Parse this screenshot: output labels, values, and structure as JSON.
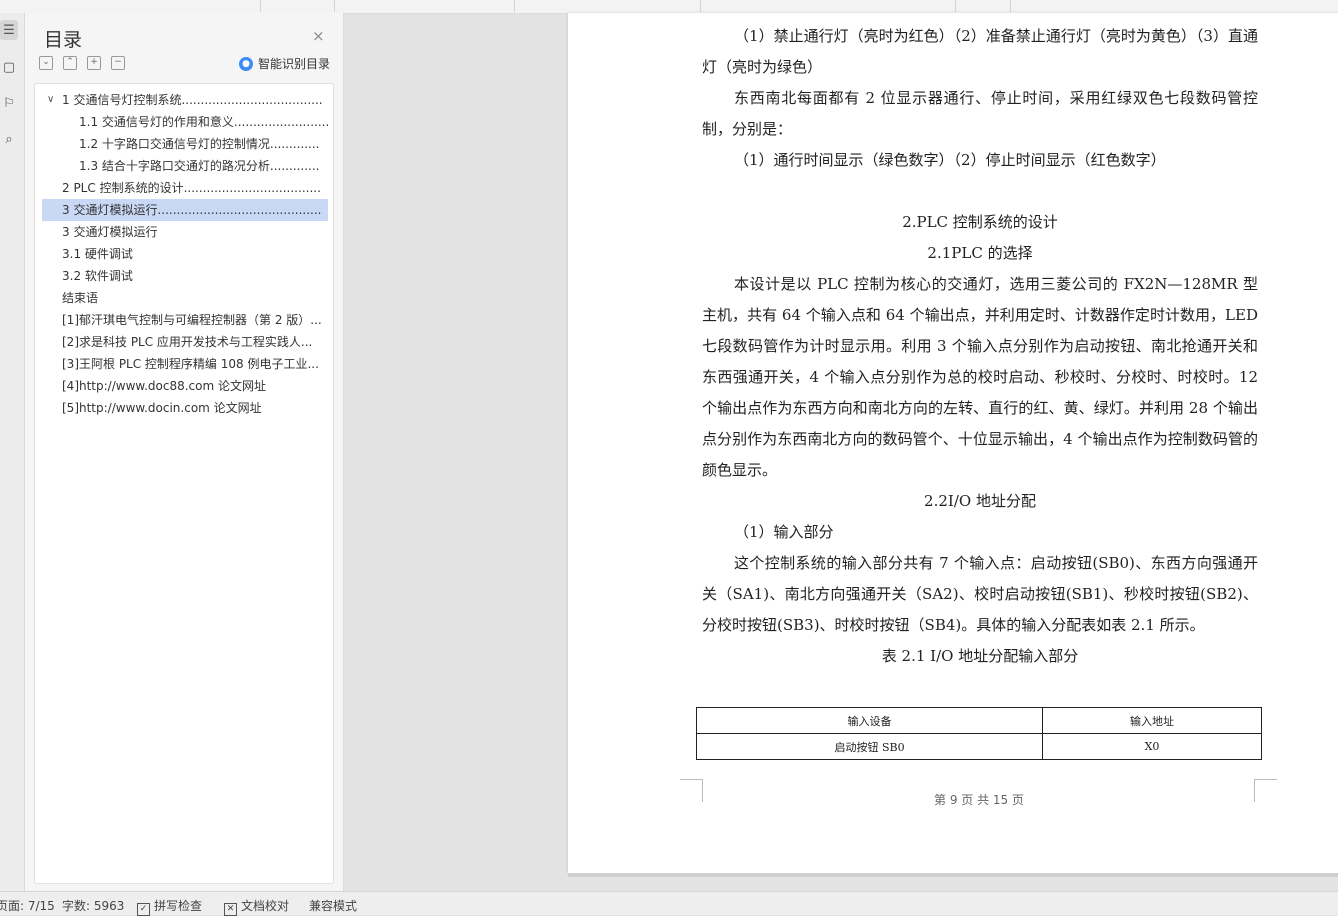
{
  "sidebar_rail": {
    "icons": [
      "toc-icon",
      "pages-icon",
      "bookmark-icon",
      "search-icon"
    ]
  },
  "toc": {
    "title": "目录",
    "close": "×",
    "tools": [
      "⌄",
      "⌃",
      "+",
      "−"
    ],
    "smart_button": "智能识别目录",
    "items": [
      {
        "label": "1 交通信号灯控制系统.......................................",
        "level": 1,
        "expanded": true
      },
      {
        "label": "1.1 交通信号灯的作用和意义...........................",
        "level": 2
      },
      {
        "label": "1.2 十字路口交通信号灯的控制情况.............",
        "level": 2
      },
      {
        "label": "1.3 结合十字路口交通灯的路况分析.............",
        "level": 2
      },
      {
        "label": "2 PLC 控制系统的设计.....................................",
        "level": 1
      },
      {
        "label": "3 交通灯模拟运行................................................",
        "level": 1,
        "selected": true
      },
      {
        "label": "3 交通灯模拟运行",
        "level": 1
      },
      {
        "label": "3.1 硬件调试",
        "level": 1
      },
      {
        "label": "3.2 软件调试",
        "level": 1
      },
      {
        "label": "结束语",
        "level": 1
      },
      {
        "label": "[1]郁汗琪电气控制与可编程控制器（第 2 版）...",
        "level": 1
      },
      {
        "label": "[2]求是科技 PLC 应用开发技术与工程实践人...",
        "level": 1
      },
      {
        "label": "[3]王阿根 PLC 控制程序精编 108 例电子工业...",
        "level": 1
      },
      {
        "label": "[4]http://www.doc88.com 论文网址",
        "level": 1
      },
      {
        "label": "[5]http://www.docin.com 论文网址",
        "level": 1
      }
    ]
  },
  "document": {
    "p1": "（1）禁止通行灯（亮时为红色）（2）准备禁止通行灯（亮时为黄色）（3）直通灯（亮时为绿色）",
    "p2": "东西南北每面都有 2 位显示器通行、停止时间，采用红绿双色七段数码管控制，分别是：",
    "p3": "（1）通行时间显示（绿色数字）（2）停止时间显示（红色数字）",
    "h1": "2.PLC 控制系统的设计",
    "h2": "2.1PLC 的选择",
    "p4": "本设计是以 PLC 控制为核心的交通灯，选用三菱公司的 FX2N—128MR 型主机，共有 64 个输入点和 64 个输出点，并利用定时、计数器作定时计数用，LED 七段数码管作为计时显示用。利用 3 个输入点分别作为启动按钮、南北抢通开关和东西强通开关，4 个输入点分别作为总的校时启动、秒校时、分校时、时校时。12 个输出点作为东西方向和南北方向的左转、直行的红、黄、绿灯。并利用 28 个输出点分别作为东西南北方向的数码管个、十位显示输出，4 个输出点作为控制数码管的颜色显示。",
    "h3": "2.2I/O 地址分配",
    "p5": "（1）输入部分",
    "p6": "这个控制系统的输入部分共有 7 个输入点：启动按钮(SB0)、东西方向强通开关（SA1)、南北方向强通开关（SA2)、校时启动按钮(SB1)、秒校时按钮(SB2)、分校时按钮(SB3)、时校时按钮（SB4)。具体的输入分配表如表 2.1 所示。",
    "table_caption": "表 2.1   I/O 地址分配输入部分",
    "table": {
      "headers": [
        "输入设备",
        "输入地址"
      ],
      "rows": [
        [
          "启动按钮 SB0",
          "X0"
        ]
      ]
    },
    "page_footer": "第 9 页 共 15 页"
  },
  "status_bar": {
    "page": "页面: 7/15",
    "words": "字数: 5963",
    "spell_check": "拼写检查",
    "doc_check": "文档校对",
    "compat": "兼容模式"
  }
}
